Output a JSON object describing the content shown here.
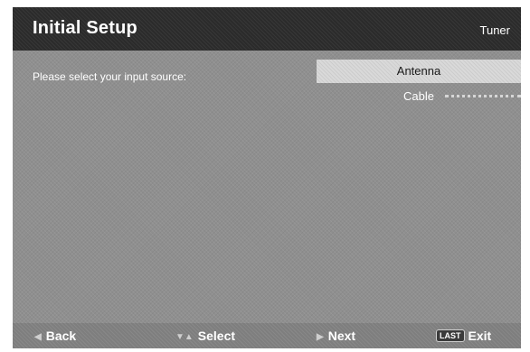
{
  "header": {
    "title": "Initial Setup",
    "section": "Tuner"
  },
  "main": {
    "prompt": "Please select your input source:",
    "options": [
      {
        "label": "Antenna",
        "selected": true
      },
      {
        "label": "Cable",
        "selected": false
      }
    ]
  },
  "footer": {
    "back": {
      "label": "Back",
      "icon": "triangle-left-icon"
    },
    "select": {
      "label": "Select",
      "icon": "up-down-arrows-icon"
    },
    "next": {
      "label": "Next",
      "icon": "triangle-right-icon"
    },
    "exit": {
      "label": "Exit",
      "badge": "LAST"
    }
  }
}
